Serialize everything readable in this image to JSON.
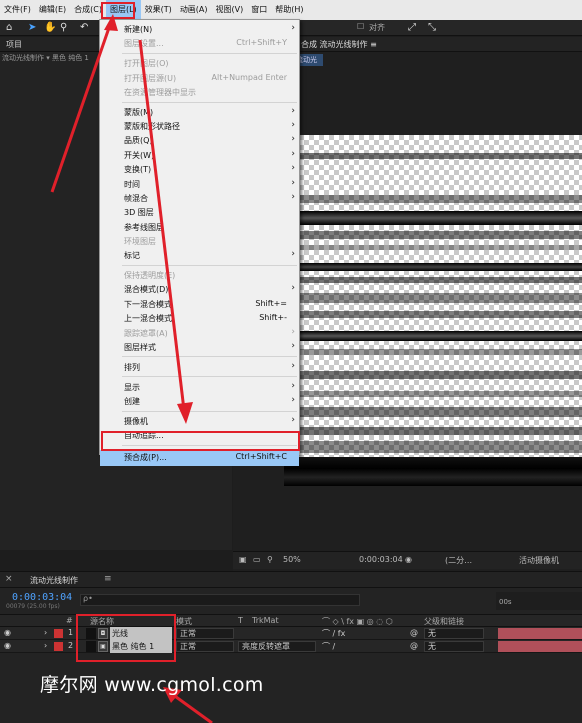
{
  "menubar": {
    "items": [
      {
        "label": "文件(F)"
      },
      {
        "label": "编辑(E)"
      },
      {
        "label": "合成(C)"
      },
      {
        "label": "图层(L)",
        "active": true
      },
      {
        "label": "效果(T)"
      },
      {
        "label": "动画(A)"
      },
      {
        "label": "视图(V)"
      },
      {
        "label": "窗口"
      },
      {
        "label": "帮助(H)"
      }
    ]
  },
  "toolbar": {
    "snap_label": "对齐"
  },
  "project_panel": {
    "tab_label": "项目",
    "info_text": "流动光线制作 ▾ 黑色 纯色 1"
  },
  "comp_panel": {
    "tab_label": "合成 流动光线制作 ≡",
    "sub_tab": "流动光"
  },
  "comp_footer": {
    "zoom": "50%",
    "timecode": "0:00:03:04",
    "resolution": "(二分…",
    "camera": "活动摄像机"
  },
  "dropdown": {
    "items": [
      {
        "label": "新建(N)",
        "shortcut": "",
        "submenu": true,
        "disabled": false
      },
      {
        "label": "图层设置...",
        "shortcut": "Ctrl+Shift+Y",
        "submenu": false,
        "disabled": true
      },
      {
        "sep": true
      },
      {
        "label": "打开图层(O)",
        "shortcut": "",
        "submenu": false,
        "disabled": true
      },
      {
        "label": "打开图层源(U)",
        "shortcut": "Alt+Numpad Enter",
        "submenu": false,
        "disabled": true
      },
      {
        "label": "在资源管理器中显示",
        "shortcut": "",
        "submenu": false,
        "disabled": true
      },
      {
        "sep": true
      },
      {
        "label": "蒙版(M)",
        "shortcut": "",
        "submenu": true,
        "disabled": false
      },
      {
        "label": "蒙版和形状路径",
        "shortcut": "",
        "submenu": true,
        "disabled": false
      },
      {
        "label": "品质(Q)",
        "shortcut": "",
        "submenu": true,
        "disabled": false
      },
      {
        "label": "开关(W)",
        "shortcut": "",
        "submenu": true,
        "disabled": false
      },
      {
        "label": "变换(T)",
        "shortcut": "",
        "submenu": true,
        "disabled": false
      },
      {
        "label": "时间",
        "shortcut": "",
        "submenu": true,
        "disabled": false
      },
      {
        "label": "帧混合",
        "shortcut": "",
        "submenu": true,
        "disabled": false
      },
      {
        "label": "3D 图层",
        "shortcut": "",
        "submenu": false,
        "disabled": false
      },
      {
        "label": "参考线图层",
        "shortcut": "",
        "submenu": false,
        "disabled": false
      },
      {
        "label": "环境图层",
        "shortcut": "",
        "submenu": false,
        "disabled": true
      },
      {
        "label": "标记",
        "shortcut": "",
        "submenu": true,
        "disabled": false
      },
      {
        "sep": true
      },
      {
        "label": "保持透明度(E)",
        "shortcut": "",
        "submenu": false,
        "disabled": true
      },
      {
        "label": "混合模式(D)",
        "shortcut": "",
        "submenu": true,
        "disabled": false
      },
      {
        "label": "下一混合模式",
        "shortcut": "Shift+=",
        "submenu": false,
        "disabled": false
      },
      {
        "label": "上一混合模式",
        "shortcut": "Shift+-",
        "submenu": false,
        "disabled": false
      },
      {
        "label": "跟踪遮罩(A)",
        "shortcut": "",
        "submenu": true,
        "disabled": true
      },
      {
        "label": "图层样式",
        "shortcut": "",
        "submenu": true,
        "disabled": false
      },
      {
        "sep": true
      },
      {
        "label": "排列",
        "shortcut": "",
        "submenu": true,
        "disabled": false
      },
      {
        "sep": true
      },
      {
        "label": "显示",
        "shortcut": "",
        "submenu": true,
        "disabled": false
      },
      {
        "label": "创建",
        "shortcut": "",
        "submenu": true,
        "disabled": false
      },
      {
        "sep": true
      },
      {
        "label": "摄像机",
        "shortcut": "",
        "submenu": true,
        "disabled": false
      },
      {
        "label": "自动追踪...",
        "shortcut": "",
        "submenu": false,
        "disabled": false
      },
      {
        "sep": true
      },
      {
        "label": "预合成(P)...",
        "shortcut": "Ctrl+Shift+C",
        "submenu": false,
        "disabled": false,
        "selected": true
      }
    ]
  },
  "timeline": {
    "tab_label": "流动光线制作",
    "timecode": "0:00:03:04",
    "frame_info": "00079 (25.00 fps)",
    "search_placeholder": "",
    "ruler_mark": "00s",
    "columns": {
      "num": "#",
      "source_name": "源名称",
      "mode": "模式",
      "t": "T",
      "trkmat": "TrkMat",
      "parent": "父级和链接"
    },
    "layers": [
      {
        "num": "1",
        "name": "光线",
        "type_icon": "◘",
        "mode": "正常",
        "trkmat": "",
        "parent": "无"
      },
      {
        "num": "2",
        "name": "黑色 纯色 1",
        "type_icon": "▣",
        "mode": "正常",
        "trkmat": "亮度反转遮罩",
        "parent": "无"
      }
    ]
  },
  "watermark": "摩尔网 www.cgmol.com",
  "colors": {
    "accent_red": "#e0202a",
    "menu_highlight": "#99c8f6",
    "timecode_blue": "#4fa3ff"
  }
}
